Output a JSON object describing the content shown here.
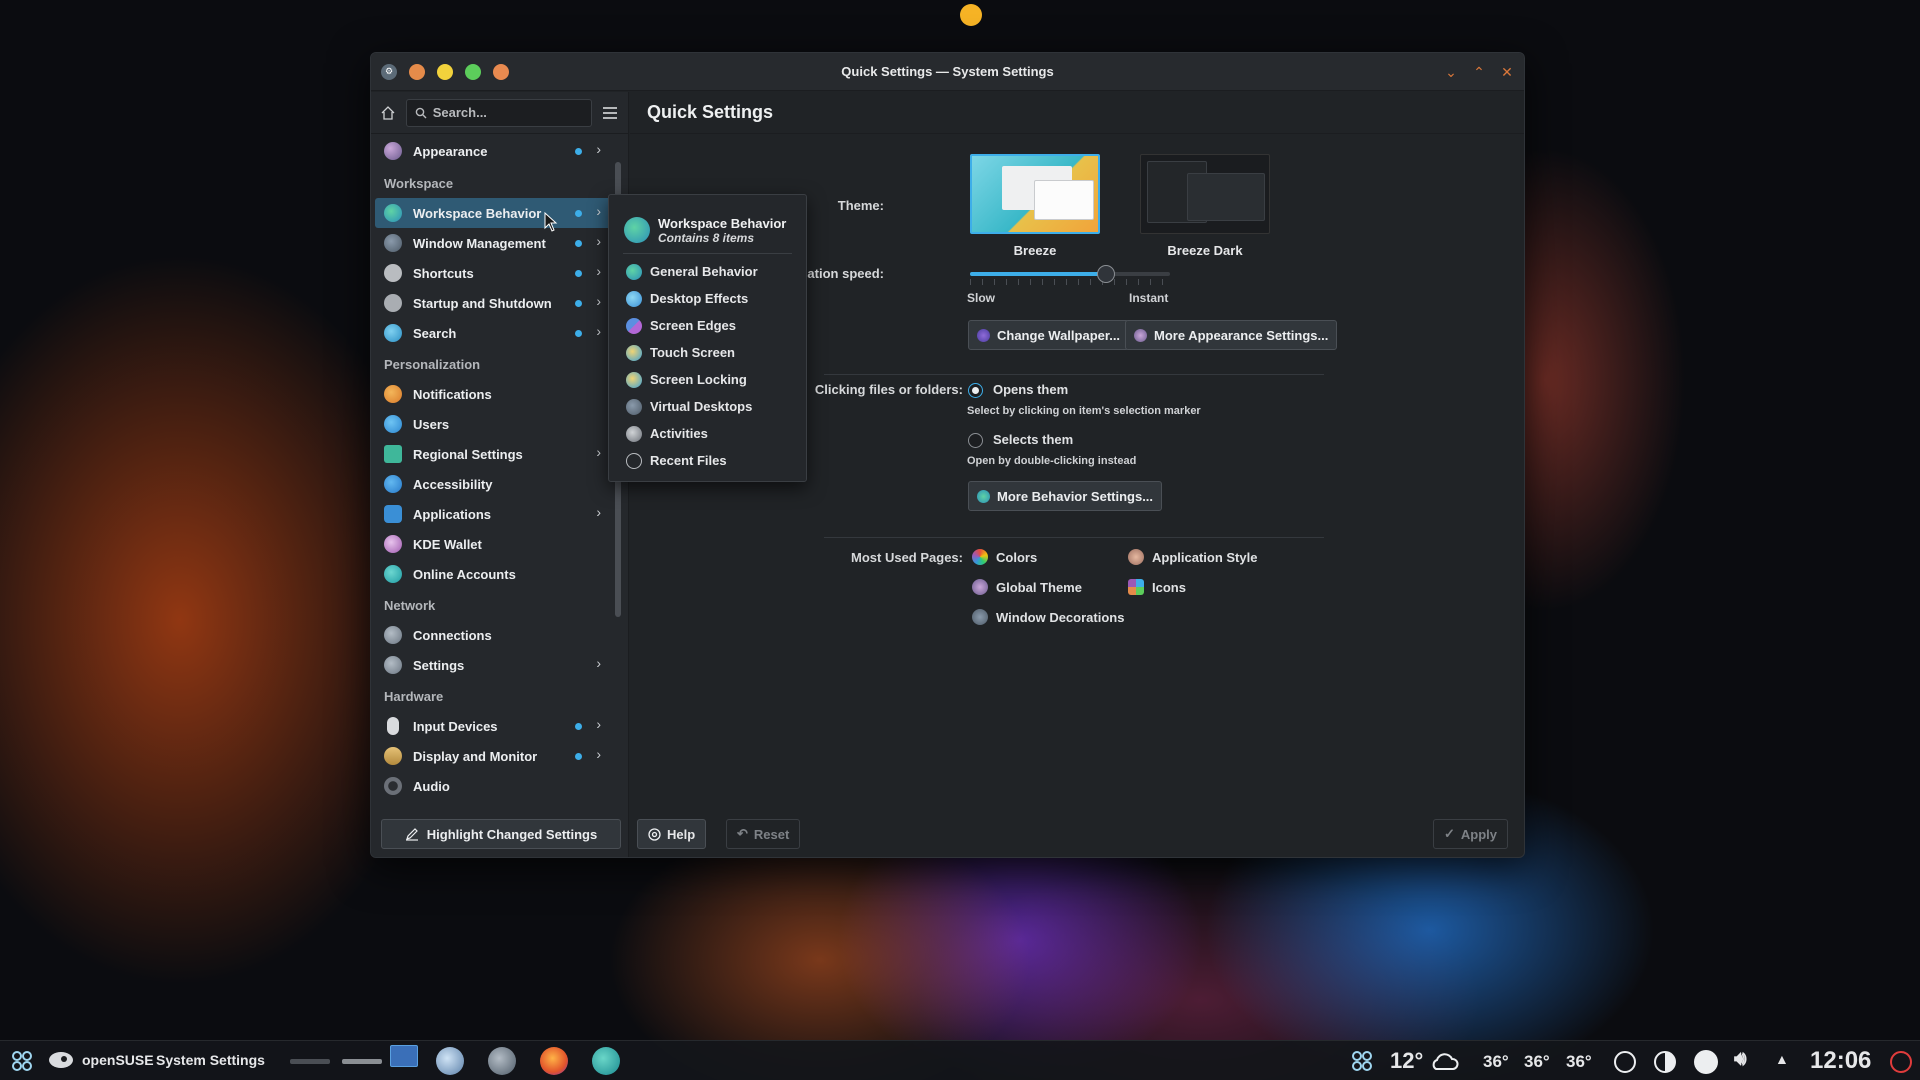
{
  "window": {
    "title": "Quick Settings — System Settings",
    "controls": {
      "minimize": "⌄",
      "maximize": "⌃",
      "close": "✕"
    }
  },
  "sidebar": {
    "search_placeholder": "Search...",
    "highlight_button": "Highlight Changed Settings",
    "top_item": {
      "label": "Appearance"
    },
    "categories": {
      "workspace": "Workspace",
      "personalization": "Personalization",
      "network": "Network",
      "hardware": "Hardware"
    },
    "workspace_items": [
      {
        "label": "Workspace Behavior"
      },
      {
        "label": "Window Management"
      },
      {
        "label": "Shortcuts"
      },
      {
        "label": "Startup and Shutdown"
      },
      {
        "label": "Search"
      }
    ],
    "personalization_items": [
      {
        "label": "Notifications"
      },
      {
        "label": "Users"
      },
      {
        "label": "Regional Settings"
      },
      {
        "label": "Accessibility"
      },
      {
        "label": "Applications"
      },
      {
        "label": "KDE Wallet"
      },
      {
        "label": "Online Accounts"
      }
    ],
    "network_items": [
      {
        "label": "Connections"
      },
      {
        "label": "Settings"
      }
    ],
    "hardware_items": [
      {
        "label": "Input Devices"
      },
      {
        "label": "Display and Monitor"
      },
      {
        "label": "Audio"
      }
    ]
  },
  "popup": {
    "title": "Workspace Behavior",
    "subtitle": "Contains 8 items",
    "items": [
      {
        "label": "General Behavior"
      },
      {
        "label": "Desktop Effects"
      },
      {
        "label": "Screen Edges"
      },
      {
        "label": "Touch Screen"
      },
      {
        "label": "Screen Locking"
      },
      {
        "label": "Virtual Desktops"
      },
      {
        "label": "Activities"
      },
      {
        "label": "Recent Files"
      }
    ]
  },
  "main": {
    "heading": "Quick Settings",
    "theme_label": "Theme:",
    "themes": [
      {
        "name": "Breeze",
        "selected": true
      },
      {
        "name": "Breeze Dark",
        "selected": false
      }
    ],
    "animation_label": "Animation speed:",
    "animation_min": "Slow",
    "animation_max": "Instant",
    "animation_value_fraction": 0.68,
    "change_wallpaper": "Change Wallpaper...",
    "more_appearance": "More Appearance Settings...",
    "clicking_label": "Clicking files or folders:",
    "opens_them": "Opens them",
    "opens_hint": "Select by clicking on item's selection marker",
    "selects_them": "Selects them",
    "selects_hint": "Open by double-clicking instead",
    "more_behavior": "More Behavior Settings...",
    "most_used_label": "Most Used Pages:",
    "most_used": {
      "colors": "Colors",
      "application_style": "Application Style",
      "global_theme": "Global Theme",
      "icons": "Icons",
      "window_decorations": "Window Decorations"
    },
    "help": "Help",
    "reset": "Reset",
    "apply": "Apply"
  },
  "taskbar": {
    "distro": "openSUSE",
    "active_app": "System Settings",
    "temperature": "12°",
    "temps": [
      "36°",
      "36°",
      "36°"
    ],
    "clock": "12:06"
  },
  "colors": {
    "accent": "#3daee9",
    "window_bg": "#202326",
    "close_orange": "#d9773a"
  }
}
